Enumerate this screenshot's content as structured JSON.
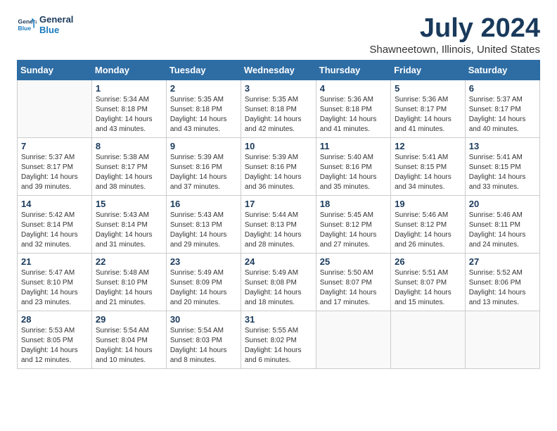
{
  "logo": {
    "text_general": "General",
    "text_blue": "Blue"
  },
  "header": {
    "title": "July 2024",
    "subtitle": "Shawneetown, Illinois, United States"
  },
  "weekdays": [
    "Sunday",
    "Monday",
    "Tuesday",
    "Wednesday",
    "Thursday",
    "Friday",
    "Saturday"
  ],
  "weeks": [
    [
      {
        "day": "",
        "sunrise": "",
        "sunset": "",
        "daylight": "",
        "empty": true
      },
      {
        "day": "1",
        "sunrise": "Sunrise: 5:34 AM",
        "sunset": "Sunset: 8:18 PM",
        "daylight": "Daylight: 14 hours and 43 minutes."
      },
      {
        "day": "2",
        "sunrise": "Sunrise: 5:35 AM",
        "sunset": "Sunset: 8:18 PM",
        "daylight": "Daylight: 14 hours and 43 minutes."
      },
      {
        "day": "3",
        "sunrise": "Sunrise: 5:35 AM",
        "sunset": "Sunset: 8:18 PM",
        "daylight": "Daylight: 14 hours and 42 minutes."
      },
      {
        "day": "4",
        "sunrise": "Sunrise: 5:36 AM",
        "sunset": "Sunset: 8:18 PM",
        "daylight": "Daylight: 14 hours and 41 minutes."
      },
      {
        "day": "5",
        "sunrise": "Sunrise: 5:36 AM",
        "sunset": "Sunset: 8:17 PM",
        "daylight": "Daylight: 14 hours and 41 minutes."
      },
      {
        "day": "6",
        "sunrise": "Sunrise: 5:37 AM",
        "sunset": "Sunset: 8:17 PM",
        "daylight": "Daylight: 14 hours and 40 minutes."
      }
    ],
    [
      {
        "day": "7",
        "sunrise": "Sunrise: 5:37 AM",
        "sunset": "Sunset: 8:17 PM",
        "daylight": "Daylight: 14 hours and 39 minutes."
      },
      {
        "day": "8",
        "sunrise": "Sunrise: 5:38 AM",
        "sunset": "Sunset: 8:17 PM",
        "daylight": "Daylight: 14 hours and 38 minutes."
      },
      {
        "day": "9",
        "sunrise": "Sunrise: 5:39 AM",
        "sunset": "Sunset: 8:16 PM",
        "daylight": "Daylight: 14 hours and 37 minutes."
      },
      {
        "day": "10",
        "sunrise": "Sunrise: 5:39 AM",
        "sunset": "Sunset: 8:16 PM",
        "daylight": "Daylight: 14 hours and 36 minutes."
      },
      {
        "day": "11",
        "sunrise": "Sunrise: 5:40 AM",
        "sunset": "Sunset: 8:16 PM",
        "daylight": "Daylight: 14 hours and 35 minutes."
      },
      {
        "day": "12",
        "sunrise": "Sunrise: 5:41 AM",
        "sunset": "Sunset: 8:15 PM",
        "daylight": "Daylight: 14 hours and 34 minutes."
      },
      {
        "day": "13",
        "sunrise": "Sunrise: 5:41 AM",
        "sunset": "Sunset: 8:15 PM",
        "daylight": "Daylight: 14 hours and 33 minutes."
      }
    ],
    [
      {
        "day": "14",
        "sunrise": "Sunrise: 5:42 AM",
        "sunset": "Sunset: 8:14 PM",
        "daylight": "Daylight: 14 hours and 32 minutes."
      },
      {
        "day": "15",
        "sunrise": "Sunrise: 5:43 AM",
        "sunset": "Sunset: 8:14 PM",
        "daylight": "Daylight: 14 hours and 31 minutes."
      },
      {
        "day": "16",
        "sunrise": "Sunrise: 5:43 AM",
        "sunset": "Sunset: 8:13 PM",
        "daylight": "Daylight: 14 hours and 29 minutes."
      },
      {
        "day": "17",
        "sunrise": "Sunrise: 5:44 AM",
        "sunset": "Sunset: 8:13 PM",
        "daylight": "Daylight: 14 hours and 28 minutes."
      },
      {
        "day": "18",
        "sunrise": "Sunrise: 5:45 AM",
        "sunset": "Sunset: 8:12 PM",
        "daylight": "Daylight: 14 hours and 27 minutes."
      },
      {
        "day": "19",
        "sunrise": "Sunrise: 5:46 AM",
        "sunset": "Sunset: 8:12 PM",
        "daylight": "Daylight: 14 hours and 26 minutes."
      },
      {
        "day": "20",
        "sunrise": "Sunrise: 5:46 AM",
        "sunset": "Sunset: 8:11 PM",
        "daylight": "Daylight: 14 hours and 24 minutes."
      }
    ],
    [
      {
        "day": "21",
        "sunrise": "Sunrise: 5:47 AM",
        "sunset": "Sunset: 8:10 PM",
        "daylight": "Daylight: 14 hours and 23 minutes."
      },
      {
        "day": "22",
        "sunrise": "Sunrise: 5:48 AM",
        "sunset": "Sunset: 8:10 PM",
        "daylight": "Daylight: 14 hours and 21 minutes."
      },
      {
        "day": "23",
        "sunrise": "Sunrise: 5:49 AM",
        "sunset": "Sunset: 8:09 PM",
        "daylight": "Daylight: 14 hours and 20 minutes."
      },
      {
        "day": "24",
        "sunrise": "Sunrise: 5:49 AM",
        "sunset": "Sunset: 8:08 PM",
        "daylight": "Daylight: 14 hours and 18 minutes."
      },
      {
        "day": "25",
        "sunrise": "Sunrise: 5:50 AM",
        "sunset": "Sunset: 8:07 PM",
        "daylight": "Daylight: 14 hours and 17 minutes."
      },
      {
        "day": "26",
        "sunrise": "Sunrise: 5:51 AM",
        "sunset": "Sunset: 8:07 PM",
        "daylight": "Daylight: 14 hours and 15 minutes."
      },
      {
        "day": "27",
        "sunrise": "Sunrise: 5:52 AM",
        "sunset": "Sunset: 8:06 PM",
        "daylight": "Daylight: 14 hours and 13 minutes."
      }
    ],
    [
      {
        "day": "28",
        "sunrise": "Sunrise: 5:53 AM",
        "sunset": "Sunset: 8:05 PM",
        "daylight": "Daylight: 14 hours and 12 minutes."
      },
      {
        "day": "29",
        "sunrise": "Sunrise: 5:54 AM",
        "sunset": "Sunset: 8:04 PM",
        "daylight": "Daylight: 14 hours and 10 minutes."
      },
      {
        "day": "30",
        "sunrise": "Sunrise: 5:54 AM",
        "sunset": "Sunset: 8:03 PM",
        "daylight": "Daylight: 14 hours and 8 minutes."
      },
      {
        "day": "31",
        "sunrise": "Sunrise: 5:55 AM",
        "sunset": "Sunset: 8:02 PM",
        "daylight": "Daylight: 14 hours and 6 minutes."
      },
      {
        "day": "",
        "sunrise": "",
        "sunset": "",
        "daylight": "",
        "empty": true
      },
      {
        "day": "",
        "sunrise": "",
        "sunset": "",
        "daylight": "",
        "empty": true
      },
      {
        "day": "",
        "sunrise": "",
        "sunset": "",
        "daylight": "",
        "empty": true
      }
    ]
  ]
}
